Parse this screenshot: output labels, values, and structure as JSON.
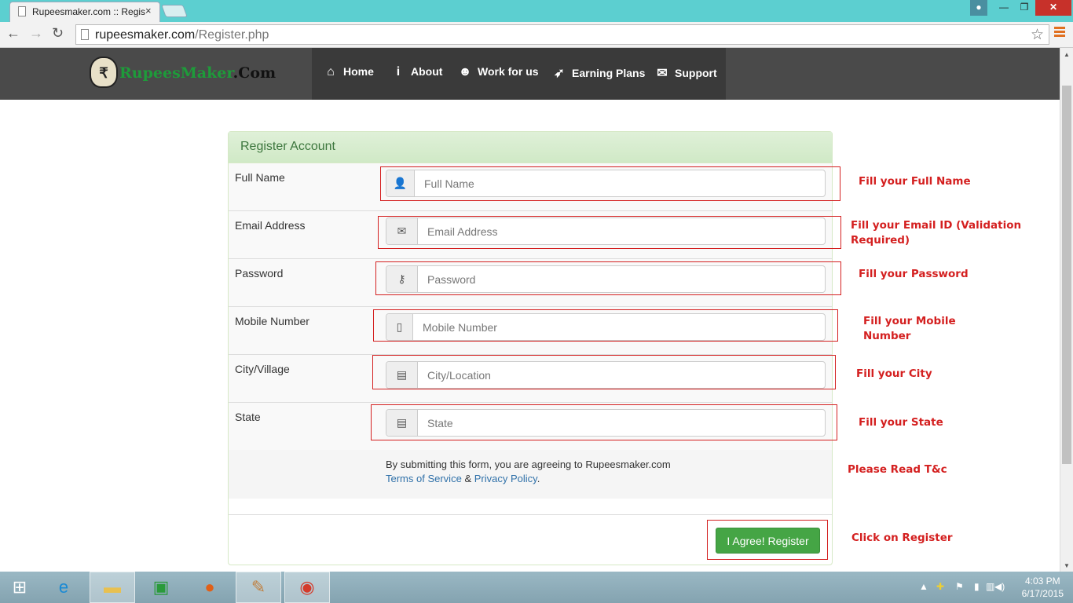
{
  "browser": {
    "tab_title": "Rupeesmaker.com :: Regis",
    "tab_close": "×",
    "url_domain": "rupeesmaker.com",
    "url_path": "/Register.php"
  },
  "site": {
    "logo_part1": "Rupees",
    "logo_part2": "Maker",
    "logo_part3": ".Com",
    "logo_symbol": "₹",
    "nav": [
      {
        "label": "Home",
        "icon": "home-icon"
      },
      {
        "label": "About",
        "icon": "info-icon"
      },
      {
        "label": "Work for us",
        "icon": "user-icon"
      },
      {
        "label": "Earning Plans",
        "icon": "rocket-icon"
      },
      {
        "label": "Support",
        "icon": "envelope-icon"
      }
    ]
  },
  "form": {
    "heading": "Register Account",
    "fields": [
      {
        "label": "Full Name",
        "placeholder": "Full Name",
        "icon": "user-icon"
      },
      {
        "label": "Email Address",
        "placeholder": "Email Address",
        "icon": "envelope-icon"
      },
      {
        "label": "Password",
        "placeholder": "Password",
        "icon": "key-icon"
      },
      {
        "label": "Mobile Number",
        "placeholder": "Mobile Number",
        "icon": "phone-icon"
      },
      {
        "label": "City/Village",
        "placeholder": "City/Location",
        "icon": "list-icon"
      },
      {
        "label": "State",
        "placeholder": "State",
        "icon": "list-icon"
      }
    ],
    "terms_text": "By submitting this form, you are agreeing to Rupeesmaker.com",
    "terms_link": "Terms of Service",
    "terms_amp": "&",
    "privacy_link": "Privacy Policy",
    "terms_end": ".",
    "submit_label": "I Agree! Register"
  },
  "annotations": {
    "fullname": "Fill your Full Name",
    "email": "Fill your Email ID (Validation Required)",
    "password": "Fill your Password",
    "mobile": "Fill your Mobile Number",
    "city": "Fill your City",
    "state": "Fill your State",
    "terms": "Please Read T&c",
    "register": "Click on Register"
  },
  "taskbar": {
    "time": "4:03 PM",
    "date": "6/17/2015"
  },
  "colors": {
    "annotation": "#d42020",
    "nav_bg": "#3a3a3a",
    "panel_head": "#dff0d8",
    "button": "#45a545"
  }
}
